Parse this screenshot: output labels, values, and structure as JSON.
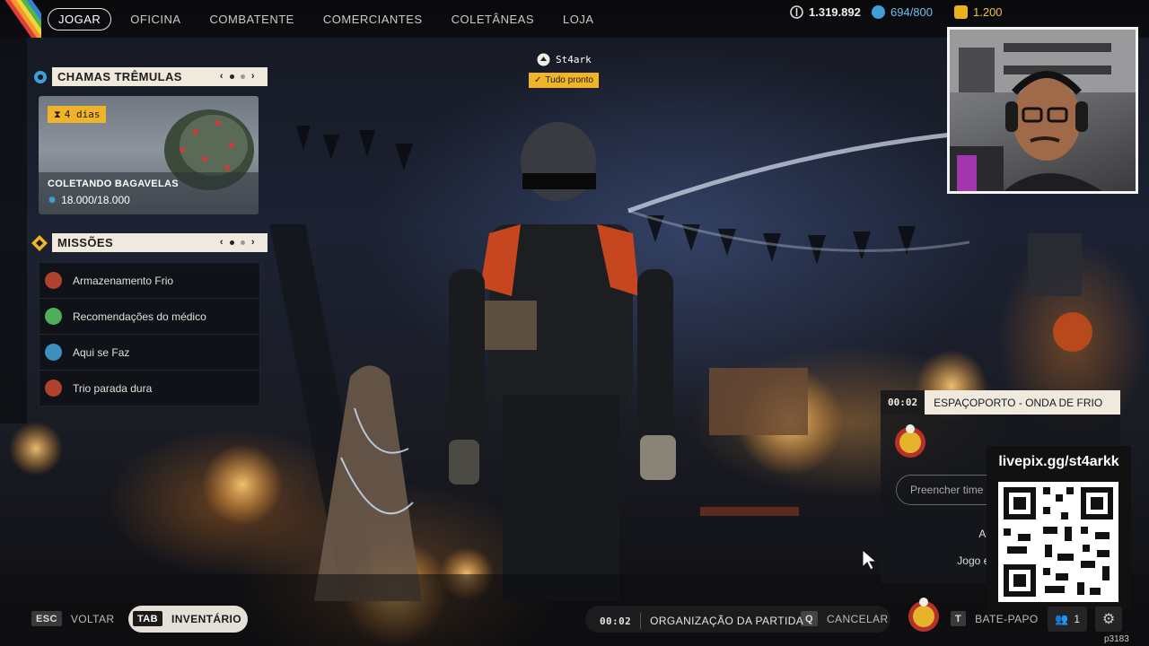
{
  "nav": {
    "items": [
      {
        "label": "JOGAR",
        "active": true
      },
      {
        "label": "OFICINA"
      },
      {
        "label": "COMBATENTE"
      },
      {
        "label": "COMERCIANTES"
      },
      {
        "label": "COLETÂNEAS"
      },
      {
        "label": "LOJA"
      }
    ]
  },
  "currencies": {
    "coins": "1.319.892",
    "cred": "694/800",
    "raider_tokens": "1.200",
    "colors": {
      "coin": "#d8d8d8",
      "cred": "#3fa0d8",
      "token": "#e8b21c"
    }
  },
  "event": {
    "header": "CHAMAS TRÊMULAS",
    "pager_left": "‹",
    "pager_right": "›",
    "timer": "4 dias",
    "title": "COLETANDO BAGAVELAS",
    "progress": "18.000/18.000"
  },
  "missions": {
    "header": "MISSÕES",
    "pager_left": "‹",
    "pager_right": "›",
    "items": [
      {
        "label": "Armazenamento Frio",
        "color": "#b0422e"
      },
      {
        "label": "Recomendações do médico",
        "color": "#4fae5a"
      },
      {
        "label": "Aqui se Faz",
        "color": "#3d8fbf"
      },
      {
        "label": "Trio parada dura",
        "color": "#b0422e"
      }
    ]
  },
  "player": {
    "name": "St4ark",
    "status": "Tudo pronto",
    "accent": "#f0b428"
  },
  "party": {
    "timer": "00:02",
    "title": "ESPAÇOPORTO - ONDA DE FRIO",
    "fill_button": "Preencher time",
    "row1": "Armament",
    "row2": "Jogo entre pl"
  },
  "overlay": {
    "livepix_url": "livepix.gg/st4arkk"
  },
  "bottom": {
    "esc_key": "ESC",
    "back_label": "VOLTAR",
    "tab_key": "TAB",
    "inventory_label": "INVENTÁRIO",
    "match_timer": "00:02",
    "match_label": "ORGANIZAÇÃO DA PARTIDA",
    "cancel_key": "Q",
    "cancel_label": "CANCELAR",
    "chat_key": "T",
    "chat_label": "BATE-PAPO",
    "friends_count": "1",
    "build_id": "p3183"
  }
}
